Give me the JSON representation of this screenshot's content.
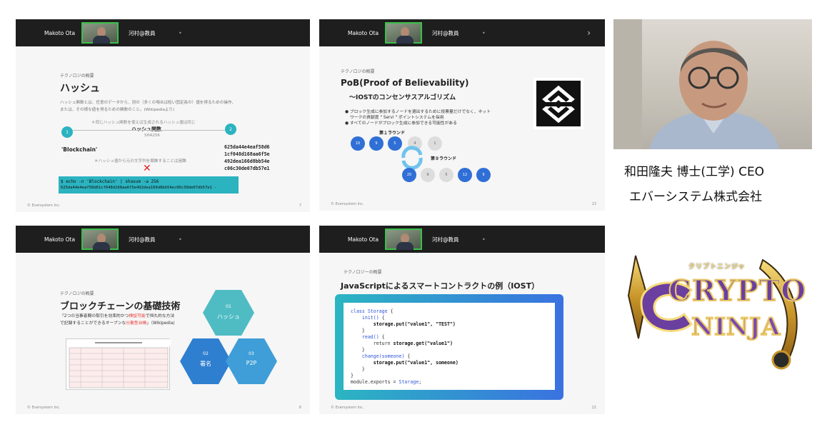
{
  "zoom": {
    "participant_1": "Makoto Ota",
    "participant_2": "河村@教員",
    "more_dot": "•",
    "arrow": "›"
  },
  "footer_text": "© Eversystem Inc.",
  "slide1": {
    "category": "テクノロジの概要",
    "title": "ハッシュ",
    "desc1": "ハッシュ関数とは、任意のデータから、別の（多くの場合は短い固定長の）値を得るための操作、",
    "desc2": "または、その様な値を得るための関数のこと。(Wikipediaより)",
    "note1": "＊同じハッシュ関数を使えば生成されるハッシュ値は同じ",
    "hash_label": "ハッシュ関数",
    "algo": "SHA256",
    "node1": "1",
    "node2": "2",
    "input": "'Blockchain'",
    "output_lines": [
      "625da44e4eaf58d6",
      "1cf048d168aa6f5e",
      "492dea166d8bb54e",
      "c06c30de07db57e1"
    ],
    "note2": "＊ハッシュ値から元の文字列を類推することは困難",
    "cross": "✕",
    "cmd": "$ echo -n 'Blockchain' | shasum -a 256",
    "cmd_out": "625da44e4eaf58d61cf048d168aa6f5e492dea166d8bb54ec06c30de07db57e1  -",
    "page": "7"
  },
  "slide2": {
    "category": "テクノロジの概要",
    "title": "PoB(Proof of Believability)",
    "subtitle": "〜IOSTのコンセンサスアルゴリズム",
    "bullet1a": "ブロック生成に参加するノードを選出するために投票量だけでなく、ネット",
    "bullet1b": "ワークの貢献度 \" Servi \" ポイントシステムを採用",
    "bullet2": "すべてのノードがブロック生成に参加できる可能性がある",
    "round1": "第１ラウンド",
    "round2": "第９ラウンド",
    "round1_nodes": [
      "10",
      "9",
      "5",
      "4",
      "1"
    ],
    "round2_nodes": [
      "20",
      "9",
      "5",
      "12",
      "9"
    ],
    "page": "13"
  },
  "slide3": {
    "category": "テクノロジの概要",
    "title": "ブロックチェーンの基礎技術",
    "quote_a": "「2つの当事者間の取引を効率的かつ",
    "quote_red1": "検証可能",
    "quote_b": "で恒久的な方法",
    "quote_c": "で記録することができるオープンな",
    "quote_red2": "分散型台帳",
    "quote_d": "」（Wikipedia)",
    "hex1_num": "01",
    "hex1_label": "ハッシュ",
    "hex2_num": "02",
    "hex2_label": "署名",
    "hex3_num": "03",
    "hex3_label": "P2P",
    "page": "6"
  },
  "slide4": {
    "category": "テクノロジーの概要",
    "title": "JavaScriptによるスマートコントラクトの例（IOST）",
    "page": "22"
  },
  "speaker": {
    "name_line": "和田隆夫 博士(工学) CEO",
    "company_line": "エバーシステム株式会社"
  },
  "logo": {
    "kana": "クリプトニンジャ",
    "word1": "CRYPTO",
    "word2": "NINJA"
  },
  "colors": {
    "zoom_bar": "#1e1e1e",
    "active_speaker": "#3bbf4a",
    "teal": "#2bb3c0",
    "node_blue": "#2f6fd6",
    "gold": "#c89a2a",
    "purple": "#4a2f7a"
  }
}
